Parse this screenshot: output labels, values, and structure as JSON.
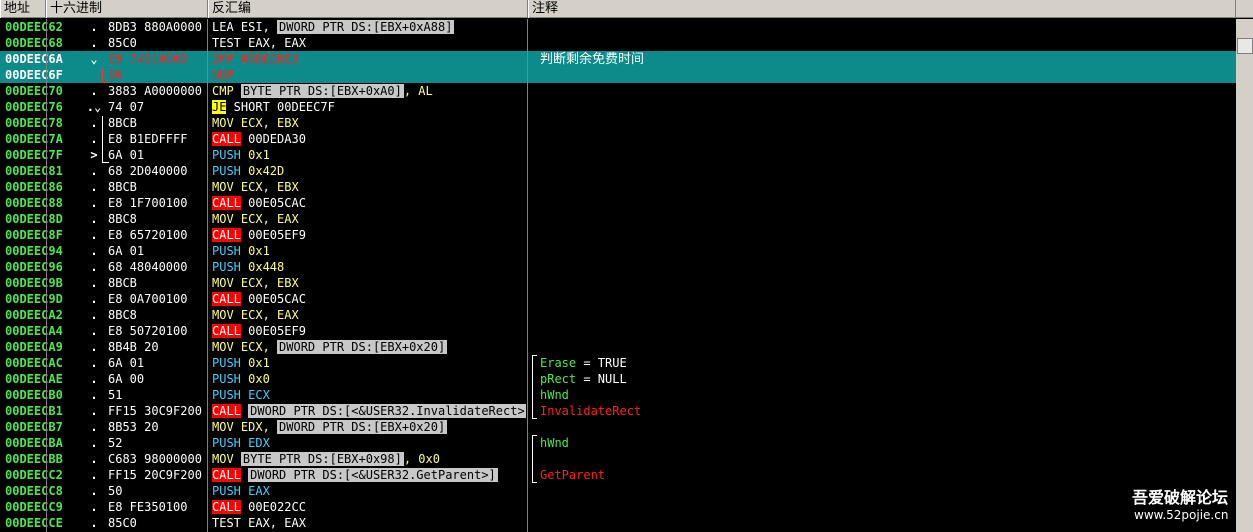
{
  "columns": {
    "addr": "地址",
    "hex": "十六进制",
    "asm": "反汇编",
    "cmt": "注释"
  },
  "rows": [
    {
      "addr": "00DEEC62",
      "mk": ".",
      "hex": "8DB3 880A0000",
      "asm": [
        [
          "t-white",
          "LEA ESI, "
        ],
        [
          "mem",
          "DWORD PTR DS:[EBX+0xA88]"
        ]
      ],
      "cmt": []
    },
    {
      "addr": "00DEEC68",
      "mk": ".",
      "hex": "85C0",
      "asm": [
        [
          "t-white",
          "TEST EAX, EAX"
        ]
      ],
      "cmt": []
    },
    {
      "addr": "00DEEC6A",
      "mk": "⌄",
      "hex": "E9 74010000",
      "asm": [
        [
          "t-jmp",
          "JMP 00DEEDE3"
        ]
      ],
      "cmt": [
        [
          "cmt-val cmt-cn",
          "判断剩余免费时间"
        ]
      ],
      "sel": true
    },
    {
      "addr": "00DEEC6F",
      "mk": "",
      "hex": "90",
      "asm": [
        [
          "t-nop",
          "NOP"
        ]
      ],
      "cmt": [],
      "sel": true
    },
    {
      "addr": "00DEEC70",
      "mk": ".",
      "hex": "3883 A0000000",
      "asm": [
        [
          "t-mov",
          "CMP "
        ],
        [
          "mem",
          "BYTE PTR DS:[EBX+0xA0]"
        ],
        [
          "t-mov",
          ", AL"
        ]
      ],
      "cmt": []
    },
    {
      "addr": "00DEEC76",
      "mk": ".⌄",
      "hex": "74 07",
      "asm": [
        [
          "t-cond",
          "JE"
        ],
        [
          "t-white",
          " SHORT 00DEEC7F"
        ]
      ],
      "cmt": []
    },
    {
      "addr": "00DEEC78",
      "mk": ".",
      "hex": "8BCB",
      "asm": [
        [
          "t-mov",
          "MOV ECX, EBX"
        ]
      ],
      "cmt": []
    },
    {
      "addr": "00DEEC7A",
      "mk": ".",
      "hex": "E8 B1EDFFFF",
      "asm": [
        [
          "t-call",
          "CALL"
        ],
        [
          "t-white",
          " 00DEDA30"
        ]
      ],
      "cmt": []
    },
    {
      "addr": "00DEEC7F",
      "mk": ">",
      "hex": "6A 01",
      "asm": [
        [
          "t-push",
          "PUSH "
        ],
        [
          "num",
          "0x1"
        ]
      ],
      "cmt": []
    },
    {
      "addr": "00DEEC81",
      "mk": ".",
      "hex": "68 2D040000",
      "asm": [
        [
          "t-push",
          "PUSH "
        ],
        [
          "num",
          "0x42D"
        ]
      ],
      "cmt": []
    },
    {
      "addr": "00DEEC86",
      "mk": ".",
      "hex": "8BCB",
      "asm": [
        [
          "t-mov",
          "MOV ECX, EBX"
        ]
      ],
      "cmt": []
    },
    {
      "addr": "00DEEC88",
      "mk": ".",
      "hex": "E8 1F700100",
      "asm": [
        [
          "t-call",
          "CALL"
        ],
        [
          "t-white",
          " 00E05CAC"
        ]
      ],
      "cmt": []
    },
    {
      "addr": "00DEEC8D",
      "mk": ".",
      "hex": "8BC8",
      "asm": [
        [
          "t-mov",
          "MOV ECX, EAX"
        ]
      ],
      "cmt": []
    },
    {
      "addr": "00DEEC8F",
      "mk": ".",
      "hex": "E8 65720100",
      "asm": [
        [
          "t-call",
          "CALL"
        ],
        [
          "t-white",
          " 00E05EF9"
        ]
      ],
      "cmt": []
    },
    {
      "addr": "00DEEC94",
      "mk": ".",
      "hex": "6A 01",
      "asm": [
        [
          "t-push",
          "PUSH "
        ],
        [
          "num",
          "0x1"
        ]
      ],
      "cmt": []
    },
    {
      "addr": "00DEEC96",
      "mk": ".",
      "hex": "68 48040000",
      "asm": [
        [
          "t-push",
          "PUSH "
        ],
        [
          "num",
          "0x448"
        ]
      ],
      "cmt": []
    },
    {
      "addr": "00DEEC9B",
      "mk": ".",
      "hex": "8BCB",
      "asm": [
        [
          "t-mov",
          "MOV ECX, EBX"
        ]
      ],
      "cmt": []
    },
    {
      "addr": "00DEEC9D",
      "mk": ".",
      "hex": "E8 0A700100",
      "asm": [
        [
          "t-call",
          "CALL"
        ],
        [
          "t-white",
          " 00E05CAC"
        ]
      ],
      "cmt": []
    },
    {
      "addr": "00DEECA2",
      "mk": ".",
      "hex": "8BC8",
      "asm": [
        [
          "t-mov",
          "MOV ECX, EAX"
        ]
      ],
      "cmt": []
    },
    {
      "addr": "00DEECA4",
      "mk": ".",
      "hex": "E8 50720100",
      "asm": [
        [
          "t-call",
          "CALL"
        ],
        [
          "t-white",
          " 00E05EF9"
        ]
      ],
      "cmt": []
    },
    {
      "addr": "00DEECA9",
      "mk": ".",
      "hex": "8B4B 20",
      "asm": [
        [
          "t-mov",
          "MOV ECX, "
        ],
        [
          "mem",
          "DWORD PTR DS:[EBX+0x20]"
        ]
      ],
      "cmt": []
    },
    {
      "addr": "00DEECAC",
      "mk": ".",
      "hex": "6A 01",
      "asm": [
        [
          "t-push",
          "PUSH "
        ],
        [
          "num",
          "0x1"
        ]
      ],
      "cmt": [
        [
          "cmt-arg",
          "Erase"
        ],
        [
          "cmt-val",
          " = TRUE"
        ]
      ]
    },
    {
      "addr": "00DEECAE",
      "mk": ".",
      "hex": "6A 00",
      "asm": [
        [
          "t-push",
          "PUSH "
        ],
        [
          "num",
          "0x0"
        ]
      ],
      "cmt": [
        [
          "cmt-arg",
          "pRect"
        ],
        [
          "cmt-val",
          " = NULL"
        ]
      ]
    },
    {
      "addr": "00DEECB0",
      "mk": ".",
      "hex": "51",
      "asm": [
        [
          "t-push",
          "PUSH ECX"
        ]
      ],
      "cmt": [
        [
          "cmt-arg",
          "hWnd"
        ]
      ]
    },
    {
      "addr": "00DEECB1",
      "mk": ".",
      "hex": "FF15 30C9F200",
      "asm": [
        [
          "t-call",
          "CALL"
        ],
        [
          "t-white",
          " "
        ],
        [
          "mem",
          "DWORD PTR DS:[<&USER32.InvalidateRect>]"
        ]
      ],
      "cmt": [
        [
          "cmt-api",
          "InvalidateRect"
        ]
      ]
    },
    {
      "addr": "00DEECB7",
      "mk": ".",
      "hex": "8B53 20",
      "asm": [
        [
          "t-mov",
          "MOV EDX, "
        ],
        [
          "mem",
          "DWORD PTR DS:[EBX+0x20]"
        ]
      ],
      "cmt": []
    },
    {
      "addr": "00DEECBA",
      "mk": ".",
      "hex": "52",
      "asm": [
        [
          "t-push",
          "PUSH EDX"
        ]
      ],
      "cmt": [
        [
          "cmt-arg",
          "hWnd"
        ]
      ]
    },
    {
      "addr": "00DEECBB",
      "mk": ".",
      "hex": "C683 98000000",
      "asm": [
        [
          "t-mov",
          "MOV "
        ],
        [
          "mem",
          "BYTE PTR DS:[EBX+0x98]"
        ],
        [
          "t-mov",
          ", 0x0"
        ]
      ],
      "cmt": []
    },
    {
      "addr": "00DEECC2",
      "mk": ".",
      "hex": "FF15 20C9F200",
      "asm": [
        [
          "t-call",
          "CALL"
        ],
        [
          "t-white",
          " "
        ],
        [
          "mem",
          "DWORD PTR DS:[<&USER32.GetParent>]"
        ]
      ],
      "cmt": [
        [
          "cmt-api",
          "GetParent"
        ]
      ]
    },
    {
      "addr": "00DEECC8",
      "mk": ".",
      "hex": "50",
      "asm": [
        [
          "t-push",
          "PUSH EAX"
        ]
      ],
      "cmt": []
    },
    {
      "addr": "00DEECC9",
      "mk": ".",
      "hex": "E8 FE350100",
      "asm": [
        [
          "t-call",
          "CALL"
        ],
        [
          "t-white",
          " 00E022CC"
        ]
      ],
      "cmt": []
    },
    {
      "addr": "00DEECCE",
      "mk": ".",
      "hex": "85C0",
      "asm": [
        [
          "t-white",
          "TEST EAX, EAX"
        ]
      ],
      "cmt": []
    }
  ],
  "watermark": {
    "line1": "吾爱破解论坛",
    "line2": "www.52pojie.cn"
  }
}
